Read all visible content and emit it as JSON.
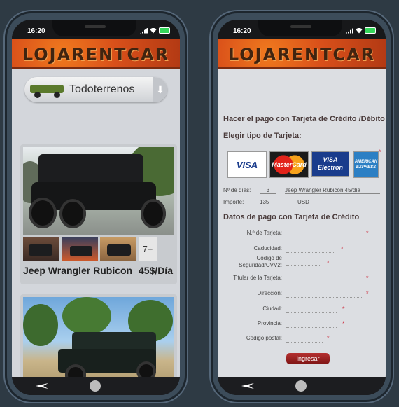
{
  "status": {
    "time": "16:20"
  },
  "brand": {
    "logo_text": "LOJARENTCAR"
  },
  "left": {
    "category_select": {
      "label": "Todoterrenos"
    },
    "listing": {
      "title": "Jeep Wrangler Rubicon",
      "price": "45$/Día",
      "more_photos": "7+"
    }
  },
  "right": {
    "heading": "Hacer el pago con Tarjeta de Crédito /Débito",
    "card_type_label": "Elegir tipo de Tarjeta:",
    "card_types": [
      "VISA",
      "MasterCard",
      "VISA Electron",
      "AMERICAN EXPRESS"
    ],
    "summary": {
      "days_label": "Nº de días:",
      "days_value": "3",
      "vehicle": "Jeep Wrangler Rubicon 45/día",
      "amount_label": "Importe:",
      "amount_value": "135",
      "currency": "USD"
    },
    "payment_heading": "Datos de pago con Tarjeta de Crédito",
    "fields": {
      "card_number": "N.º de Tarjeta:",
      "expiry": "Caducidad:",
      "security_code": "Código de Seguridad/CVV2:",
      "holder": "Titular de la Tarjeta:",
      "address": "Dirección:",
      "city": "Ciudad:",
      "province": "Provincia:",
      "postal_code": "Codigo postal:"
    },
    "submit_label": "Ingresar"
  },
  "colors": {
    "banner": "#d9501a",
    "accent_red": "#b53030",
    "bg": "#2e3a44"
  }
}
